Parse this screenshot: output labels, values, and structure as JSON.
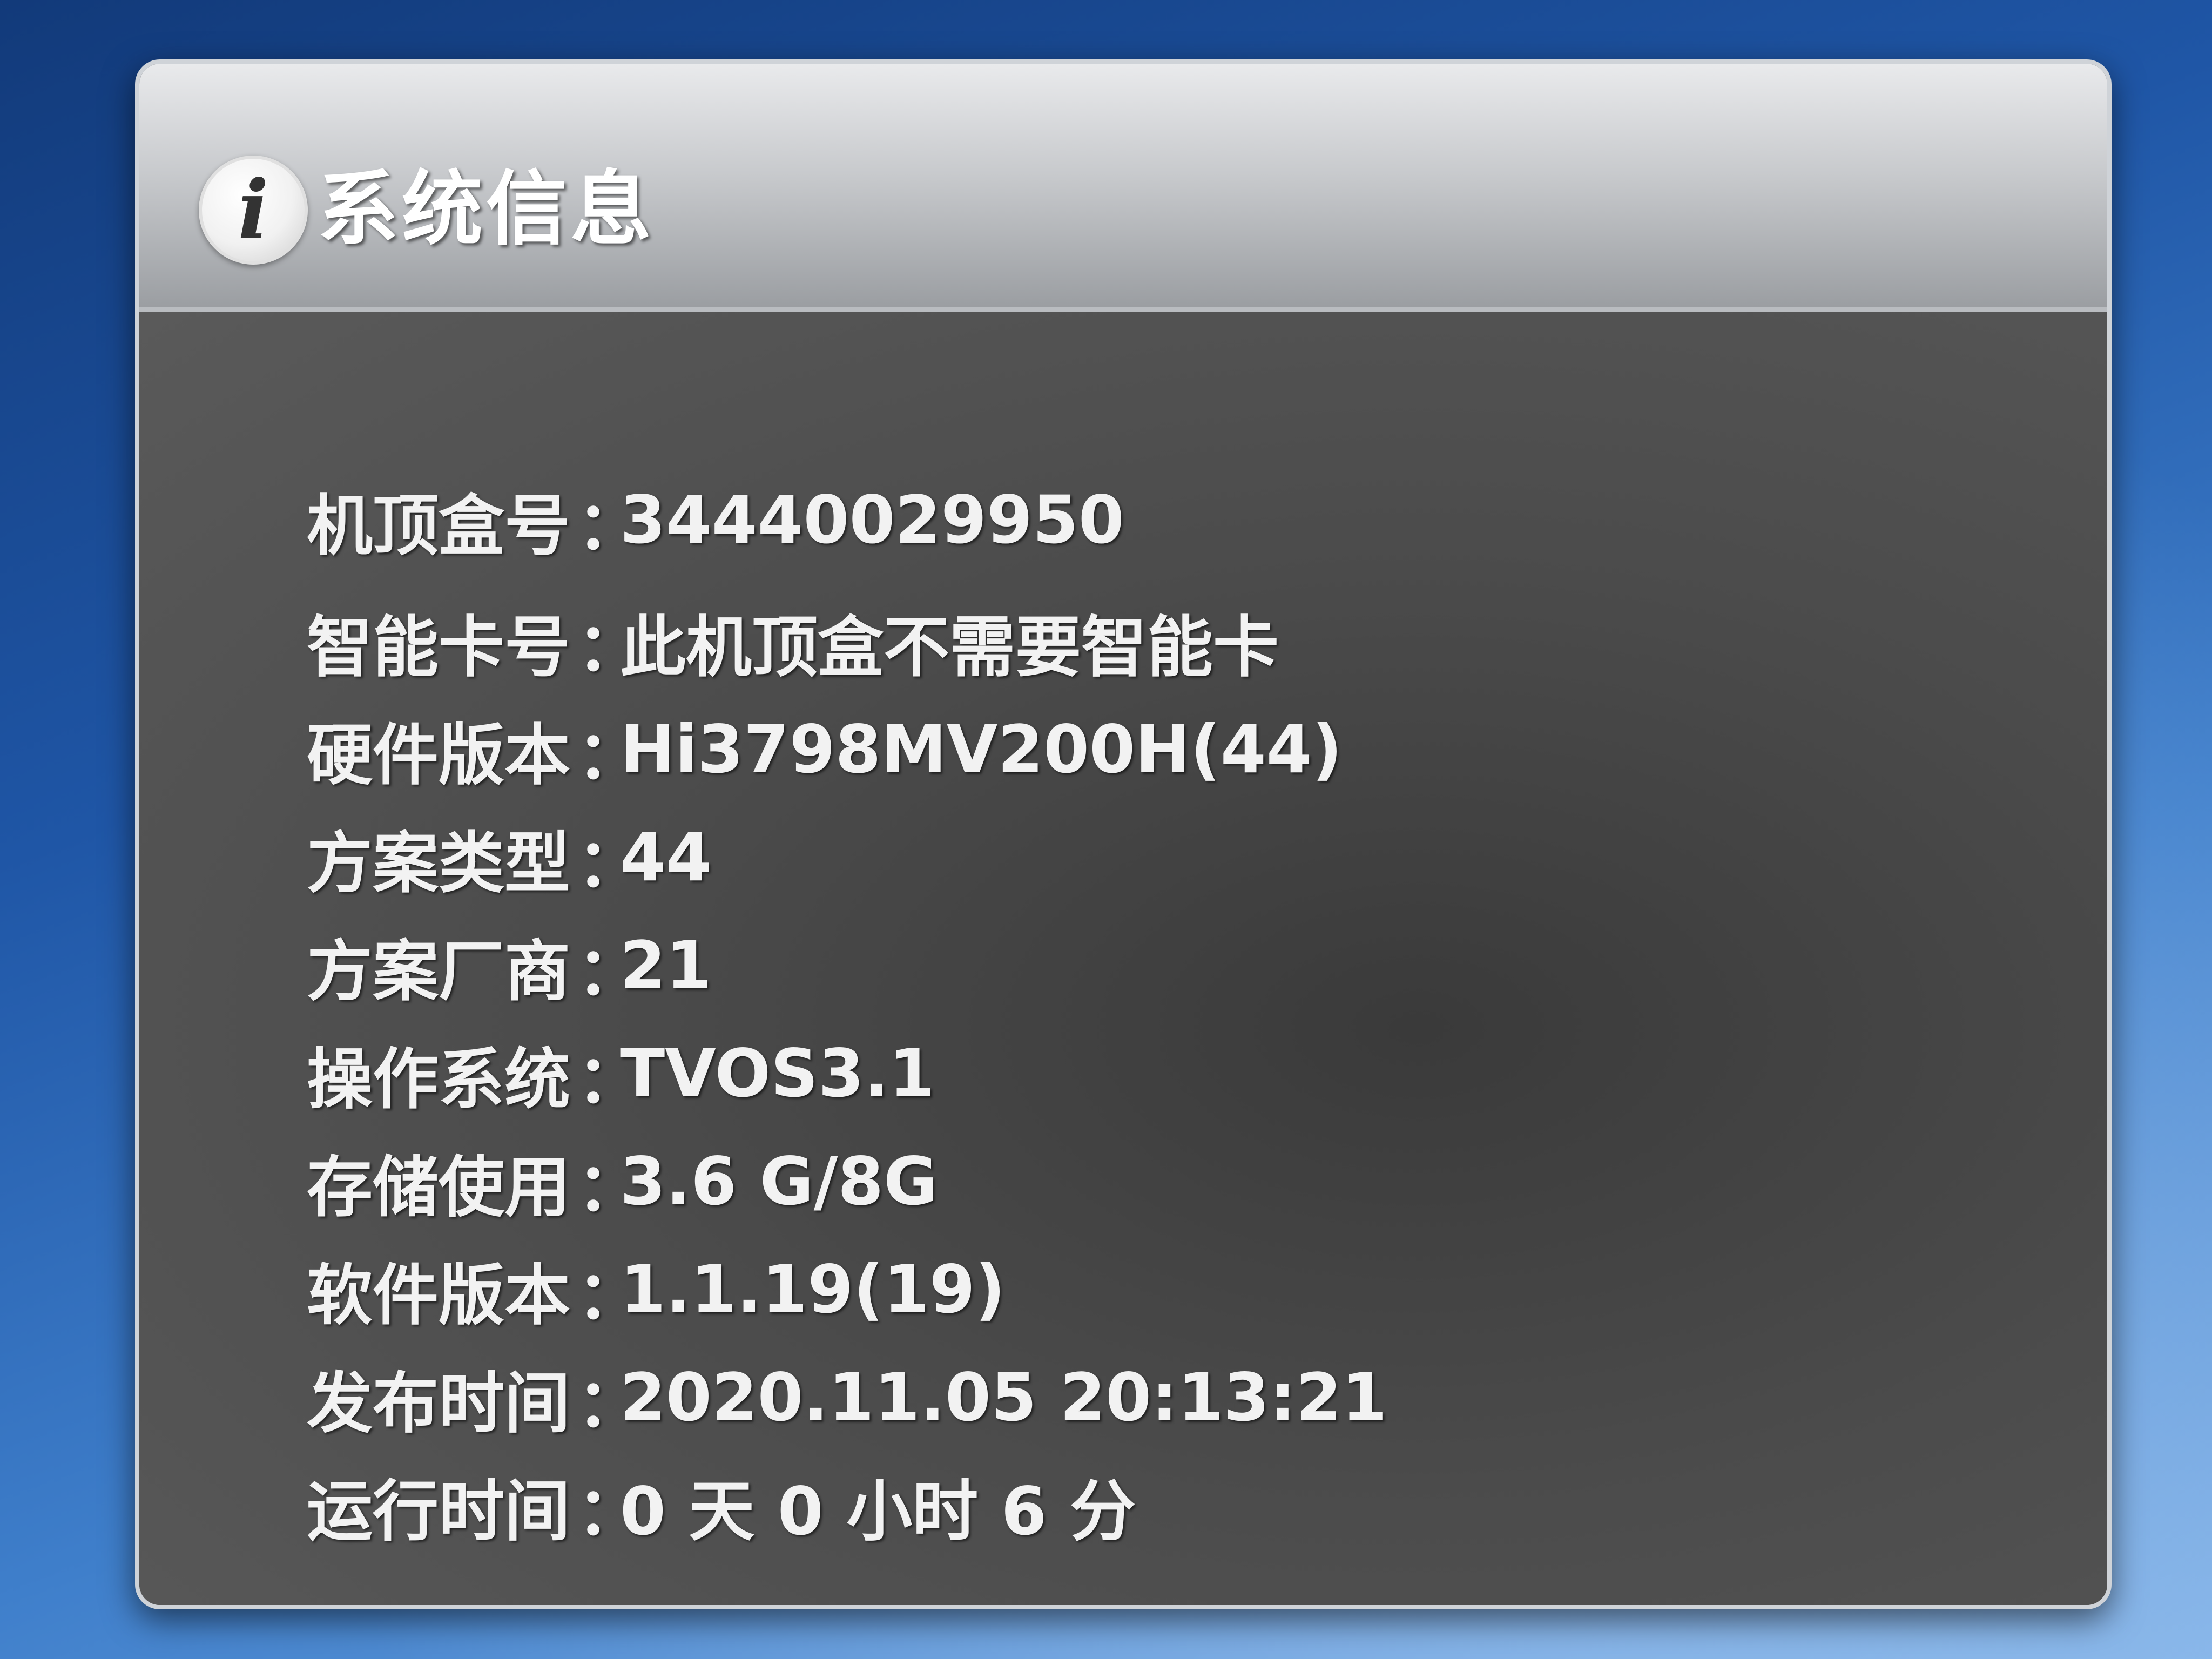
{
  "dialog": {
    "title": "系统信息",
    "icon": "info-icon",
    "separator": "：",
    "rows": [
      {
        "label": "机顶盒号",
        "value": "34440029950"
      },
      {
        "label": "智能卡号",
        "value": "此机顶盒不需要智能卡"
      },
      {
        "label": "硬件版本",
        "value": "Hi3798MV200H(44)"
      },
      {
        "label": "方案类型",
        "value": "44"
      },
      {
        "label": "方案厂商",
        "value": "21"
      },
      {
        "label": "操作系统",
        "value": "TVOS3.1"
      },
      {
        "label": "存储使用",
        "value": "3.6 G/8G"
      },
      {
        "label": "软件版本",
        "value": "1.1.19(19)"
      },
      {
        "label": "发布时间",
        "value": "2020.11.05 20:13:21"
      },
      {
        "label": "运行时间",
        "value": "0 天 0 小时 6 分"
      }
    ]
  }
}
